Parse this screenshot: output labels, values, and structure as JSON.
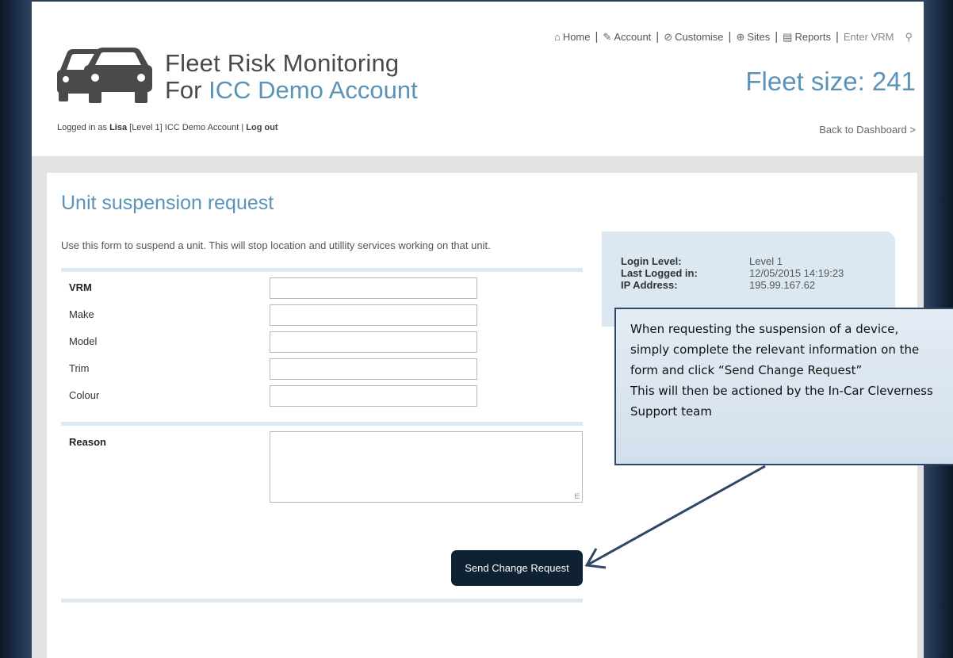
{
  "header": {
    "brand_line1": "Fleet Risk Monitoring",
    "brand_line2_prefix": "For ",
    "brand_line2_account": "ICC Demo Account",
    "fleet_size_label": "Fleet size: 241",
    "nav": {
      "home": "Home",
      "account": "Account",
      "customise": "Customise",
      "sites": "Sites",
      "reports": "Reports",
      "enter_vrm": "Enter VRM",
      "separator": "|"
    },
    "login": {
      "prefix": "Logged in as ",
      "user": "Lisa",
      "level": " [Level 1]  ICC Demo Account  | ",
      "logout": "Log out"
    },
    "back_link": "Back to Dashboard >"
  },
  "form": {
    "title": "Unit suspension request",
    "intro": "Use this form to suspend a unit. This will stop location and utillity services working on that unit.",
    "fields": {
      "vrm": "VRM",
      "make": "Make",
      "model": "Model",
      "trim": "Trim",
      "colour": "Colour",
      "reason": "Reason"
    },
    "submit_label": "Send Change Request"
  },
  "info_panel": {
    "login_level_label": "Login Level:",
    "login_level_value": "Level 1",
    "last_logged_label": "Last Logged in:",
    "last_logged_value": "12/05/2015 14:19:23",
    "ip_label": "IP Address:",
    "ip_value": "195.99.167.62"
  },
  "callout": {
    "line1": "When requesting the suspension of a device, simply complete the relevant information on the form and click “Send Change Request”",
    "line2": "This will then be actioned by the In-Car Cleverness Support team"
  },
  "colors": {
    "accent": "#5b93b8",
    "button_bg": "#0f2233",
    "panel_bg": "#dce8f1",
    "frame": "#1b2c44"
  }
}
